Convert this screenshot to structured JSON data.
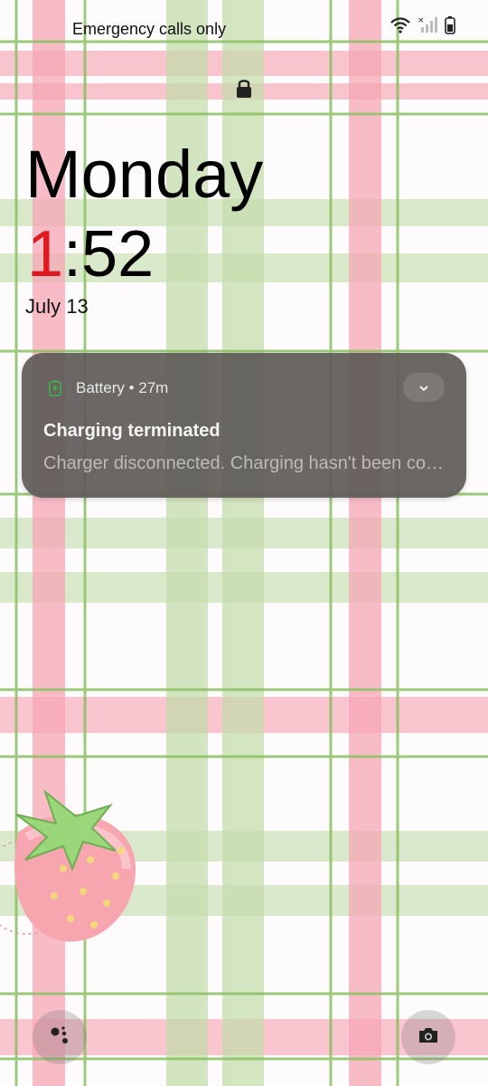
{
  "status_bar": {
    "carrier_text": "Emergency calls only",
    "icons": [
      "wifi-icon",
      "no-signal-icon",
      "battery-icon"
    ]
  },
  "lock_screen": {
    "lock_icon": "padlock-icon",
    "day": "Monday",
    "time_hour": "1",
    "time_rest": ":52",
    "date": "July 13"
  },
  "notification": {
    "app_icon": "battery-charging-icon",
    "app_line": "Battery • 27m",
    "title": "Charging terminated",
    "body": "Charger disconnected. Charging hasn't been completed."
  },
  "shortcuts": {
    "left": "assistant-icon",
    "right": "camera-icon"
  },
  "colors": {
    "clock_hour": "#e0191f",
    "plaid_pink": "#f6a7b5",
    "plaid_green": "#c9dfb2",
    "plaid_line": "#8cc063",
    "notification_bg": "#5f5b58"
  }
}
